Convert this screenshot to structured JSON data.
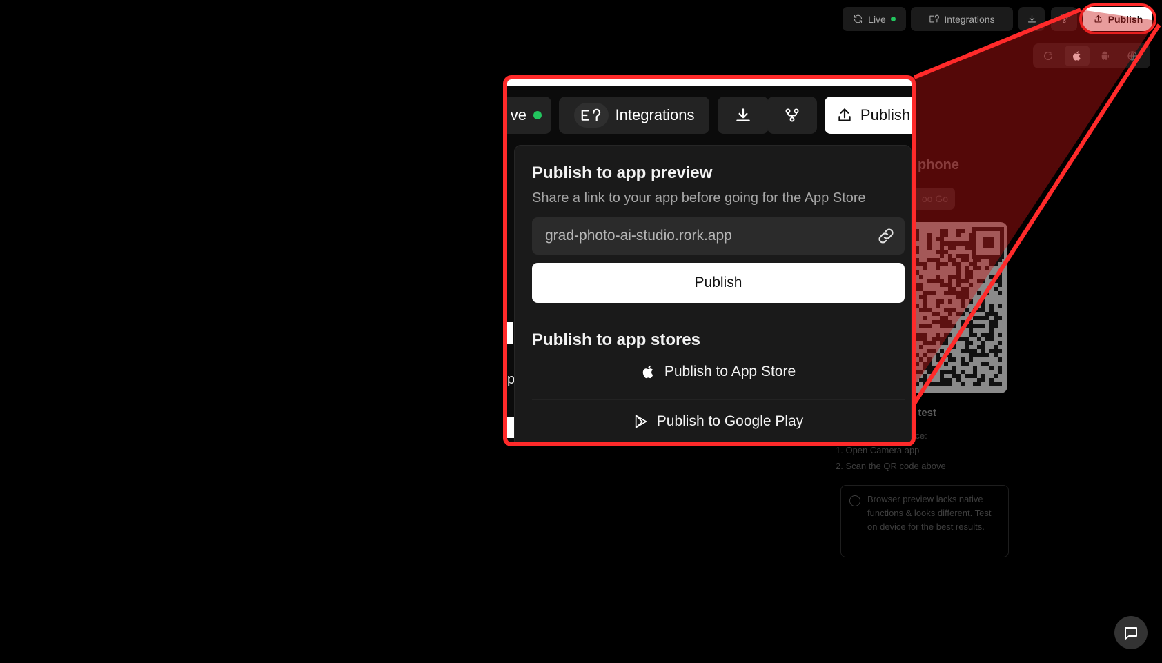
{
  "toolbar": {
    "live_label": "Live",
    "integrations_label": "Integrations",
    "publish_label": "Publish",
    "live_status_color": "#22c55e"
  },
  "device_toolbar": {
    "selected_platform": "ios"
  },
  "background_panel": {
    "title_fragment": "phone",
    "expo_fragment": "oo Go",
    "scan_fragment": "o test",
    "device_fragment": "vice:",
    "steps": [
      "1. Open Camera app",
      "2. Scan the QR code above"
    ],
    "note": "Browser preview lacks native functions & looks different. Test on device for the best results."
  },
  "zoom": {
    "toolbar": {
      "live_fragment": "ve",
      "integrations_label": "Integrations",
      "publish_label": "Publish"
    },
    "dropdown": {
      "preview_heading": "Publish to app preview",
      "preview_subtitle": "Share a link to your app before going for the App Store",
      "url_value": "grad-photo-ai-studio.rork.app",
      "publish_button": "Publish",
      "stores_heading": "Publish to app stores",
      "app_store_label": "Publish to App Store",
      "google_play_label": "Publish to Google Play"
    },
    "edge_fragment": "p"
  },
  "colors": {
    "highlight": "#ff2a2a",
    "background": "#000000",
    "accent_live": "#22c55e"
  }
}
